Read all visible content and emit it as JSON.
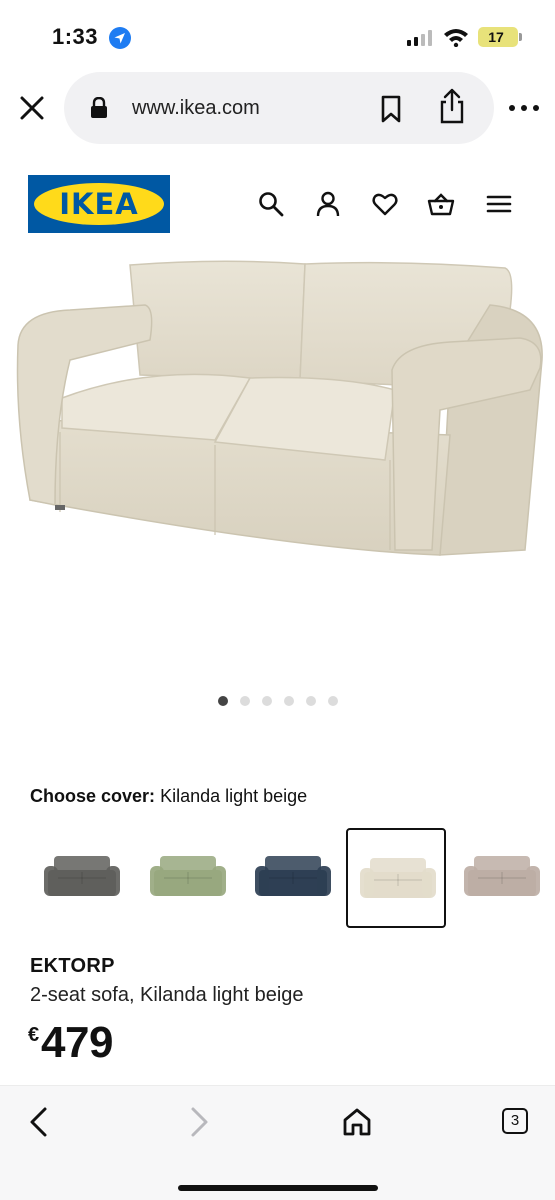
{
  "status_bar": {
    "time": "1:33",
    "battery": "17"
  },
  "browser": {
    "url": "www.ikea.com",
    "tab_count": "3"
  },
  "site": {
    "logo_text": "IKEA",
    "header_icons": [
      "search-icon",
      "account-icon",
      "heart-icon",
      "basket-icon",
      "menu-icon"
    ]
  },
  "gallery": {
    "total_images": 6,
    "active_index": 0
  },
  "cover": {
    "label": "Choose cover:",
    "value": "Kilanda light beige",
    "options": [
      {
        "color": "#5f5f5c",
        "selected": false
      },
      {
        "color": "#98a87f",
        "selected": false
      },
      {
        "color": "#2e3f54",
        "selected": false
      },
      {
        "color": "#e3dccb",
        "selected": true
      },
      {
        "color": "#bdaea5",
        "selected": false
      }
    ]
  },
  "product": {
    "name": "EKTORP",
    "description": "2-seat sofa, Kilanda light beige",
    "currency": "€",
    "price": "479"
  },
  "colors": {
    "ikea_blue": "#0058a3",
    "ikea_yellow": "#ffda1a",
    "sofa_beige": "#e6e0d0"
  }
}
